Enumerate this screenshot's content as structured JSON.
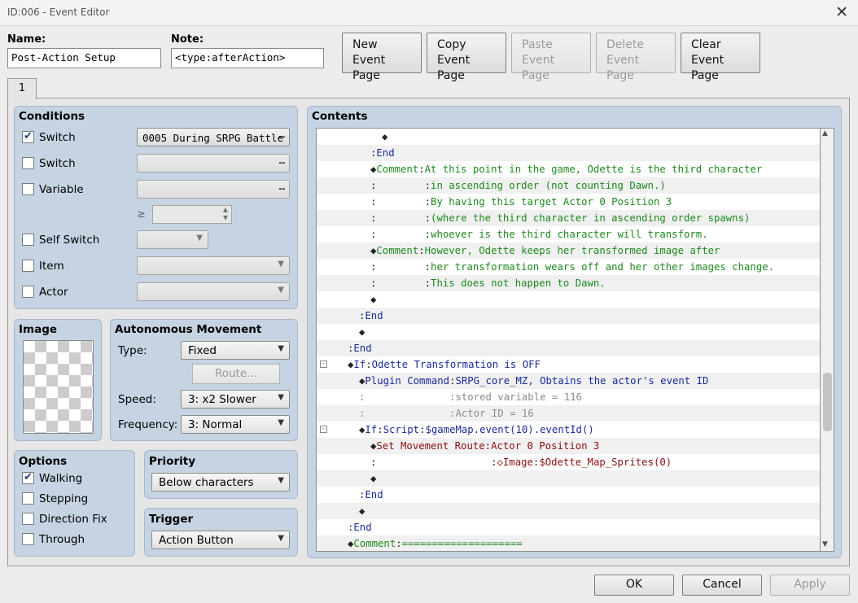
{
  "window": {
    "title": "ID:006 - Event Editor"
  },
  "header": {
    "name_label": "Name:",
    "name_value": "Post-Action Setup",
    "note_label": "Note:",
    "note_value": "<type:afterAction>"
  },
  "page_buttons": [
    {
      "line1": "New",
      "line2": "Event Page",
      "enabled": true
    },
    {
      "line1": "Copy",
      "line2": "Event Page",
      "enabled": true
    },
    {
      "line1": "Paste",
      "line2": "Event Page",
      "enabled": false
    },
    {
      "line1": "Delete",
      "line2": "Event Page",
      "enabled": false
    },
    {
      "line1": "Clear",
      "line2": "Event Page",
      "enabled": true
    }
  ],
  "tabs": [
    {
      "label": "1"
    }
  ],
  "conditions": {
    "title": "Conditions",
    "switch1": {
      "label": "Switch",
      "checked": true,
      "value": "0005 During SRPG Battle"
    },
    "switch2": {
      "label": "Switch",
      "checked": false,
      "value": ""
    },
    "variable": {
      "label": "Variable",
      "checked": false,
      "value": "",
      "operator": "≥"
    },
    "self_switch": {
      "label": "Self Switch",
      "checked": false
    },
    "item": {
      "label": "Item",
      "checked": false
    },
    "actor": {
      "label": "Actor",
      "checked": false
    }
  },
  "image_panel": {
    "title": "Image"
  },
  "autonomous_movement": {
    "title": "Autonomous Movement",
    "type_label": "Type:",
    "type_value": "Fixed",
    "route_button": "Route...",
    "speed_label": "Speed:",
    "speed_value": "3: x2 Slower",
    "frequency_label": "Frequency:",
    "frequency_value": "3: Normal"
  },
  "options": {
    "title": "Options",
    "walking": {
      "label": "Walking",
      "checked": true
    },
    "stepping": {
      "label": "Stepping",
      "checked": false
    },
    "direction_fix": {
      "label": "Direction Fix",
      "checked": false
    },
    "through": {
      "label": "Through",
      "checked": false
    }
  },
  "priority": {
    "title": "Priority",
    "value": "Below characters"
  },
  "trigger": {
    "title": "Trigger",
    "value": "Action Button"
  },
  "contents": {
    "title": "Contents",
    "lines": [
      {
        "indent": 5,
        "fold": "",
        "parts": [
          {
            "t": "◆",
            "c": "c-dark"
          }
        ]
      },
      {
        "indent": 4,
        "fold": "",
        "parts": [
          {
            "t": ":",
            "c": "c-dark"
          },
          {
            "t": "End",
            "c": "c-blue"
          }
        ]
      },
      {
        "indent": 4,
        "fold": "",
        "parts": [
          {
            "t": "◆",
            "c": "c-dark"
          },
          {
            "t": "Comment",
            "c": "c-green"
          },
          {
            "t": ":",
            "c": "c-dark"
          },
          {
            "t": "At this point in the game, Odette is the third character",
            "c": "c-green"
          }
        ]
      },
      {
        "indent": 4,
        "fold": "",
        "parts": [
          {
            "t": ":        :",
            "c": "c-dark"
          },
          {
            "t": "in ascending order (not counting Dawn.)",
            "c": "c-green"
          }
        ]
      },
      {
        "indent": 4,
        "fold": "",
        "parts": [
          {
            "t": ":        :",
            "c": "c-dark"
          },
          {
            "t": "By having this target Actor 0 Position 3",
            "c": "c-green"
          }
        ]
      },
      {
        "indent": 4,
        "fold": "",
        "parts": [
          {
            "t": ":        :",
            "c": "c-dark"
          },
          {
            "t": "(where the third character in ascending order spawns)",
            "c": "c-green"
          }
        ]
      },
      {
        "indent": 4,
        "fold": "",
        "parts": [
          {
            "t": ":        :",
            "c": "c-dark"
          },
          {
            "t": "whoever is the third character will transform.",
            "c": "c-green"
          }
        ]
      },
      {
        "indent": 4,
        "fold": "",
        "parts": [
          {
            "t": "◆",
            "c": "c-dark"
          },
          {
            "t": "Comment",
            "c": "c-green"
          },
          {
            "t": ":",
            "c": "c-dark"
          },
          {
            "t": "However, Odette keeps her transformed image after",
            "c": "c-green"
          }
        ]
      },
      {
        "indent": 4,
        "fold": "",
        "parts": [
          {
            "t": ":        :",
            "c": "c-dark"
          },
          {
            "t": "her transformation wears off and her other images change.",
            "c": "c-green"
          }
        ]
      },
      {
        "indent": 4,
        "fold": "",
        "parts": [
          {
            "t": ":        :",
            "c": "c-dark"
          },
          {
            "t": "This does not happen to Dawn.",
            "c": "c-green"
          }
        ]
      },
      {
        "indent": 4,
        "fold": "",
        "parts": [
          {
            "t": "◆",
            "c": "c-dark"
          }
        ]
      },
      {
        "indent": 3,
        "fold": "",
        "parts": [
          {
            "t": ":",
            "c": "c-dark"
          },
          {
            "t": "End",
            "c": "c-blue"
          }
        ]
      },
      {
        "indent": 3,
        "fold": "",
        "parts": [
          {
            "t": "◆",
            "c": "c-dark"
          }
        ]
      },
      {
        "indent": 2,
        "fold": "",
        "parts": [
          {
            "t": ":",
            "c": "c-dark"
          },
          {
            "t": "End",
            "c": "c-blue"
          }
        ]
      },
      {
        "indent": 2,
        "fold": "⊟",
        "parts": [
          {
            "t": "◆",
            "c": "c-dark"
          },
          {
            "t": "If",
            "c": "c-blue"
          },
          {
            "t": ":",
            "c": "c-dark"
          },
          {
            "t": "Odette Transformation is OFF",
            "c": "c-blue"
          }
        ]
      },
      {
        "indent": 3,
        "fold": "",
        "parts": [
          {
            "t": "◆",
            "c": "c-dark"
          },
          {
            "t": "Plugin Command",
            "c": "c-blue"
          },
          {
            "t": ":",
            "c": "c-dark"
          },
          {
            "t": "SRPG_core_MZ, Obtains the actor's event ID",
            "c": "c-blue"
          }
        ]
      },
      {
        "indent": 3,
        "fold": "",
        "parts": [
          {
            "t": ":              :",
            "c": "c-gray"
          },
          {
            "t": "stored variable = 116",
            "c": "c-gray"
          }
        ]
      },
      {
        "indent": 3,
        "fold": "",
        "parts": [
          {
            "t": ":              :",
            "c": "c-gray"
          },
          {
            "t": "Actor ID = 16",
            "c": "c-gray"
          }
        ]
      },
      {
        "indent": 3,
        "fold": "⊟",
        "parts": [
          {
            "t": "◆",
            "c": "c-dark"
          },
          {
            "t": "If",
            "c": "c-blue"
          },
          {
            "t": ":",
            "c": "c-dark"
          },
          {
            "t": "Script",
            "c": "c-blue"
          },
          {
            "t": ":",
            "c": "c-dark"
          },
          {
            "t": "$gameMap.event(10).eventId()",
            "c": "c-blue"
          }
        ]
      },
      {
        "indent": 4,
        "fold": "",
        "parts": [
          {
            "t": "◆",
            "c": "c-dark"
          },
          {
            "t": "Set Movement Route",
            "c": "c-red"
          },
          {
            "t": ":",
            "c": "c-dark"
          },
          {
            "t": "Actor 0 Position 3",
            "c": "c-red"
          }
        ]
      },
      {
        "indent": 4,
        "fold": "",
        "parts": [
          {
            "t": ":                   :",
            "c": "c-dark"
          },
          {
            "t": "◇Image",
            "c": "c-red"
          },
          {
            "t": ":",
            "c": "c-dark"
          },
          {
            "t": "$Odette_Map_Sprites(0)",
            "c": "c-red"
          }
        ]
      },
      {
        "indent": 4,
        "fold": "",
        "parts": [
          {
            "t": "◆",
            "c": "c-dark"
          }
        ]
      },
      {
        "indent": 3,
        "fold": "",
        "parts": [
          {
            "t": ":",
            "c": "c-dark"
          },
          {
            "t": "End",
            "c": "c-blue"
          }
        ]
      },
      {
        "indent": 3,
        "fold": "",
        "parts": [
          {
            "t": "◆",
            "c": "c-dark"
          }
        ]
      },
      {
        "indent": 2,
        "fold": "",
        "parts": [
          {
            "t": ":",
            "c": "c-dark"
          },
          {
            "t": "End",
            "c": "c-blue"
          }
        ]
      },
      {
        "indent": 2,
        "fold": "",
        "parts": [
          {
            "t": "◆",
            "c": "c-dark"
          },
          {
            "t": "Comment",
            "c": "c-green"
          },
          {
            "t": ":",
            "c": "c-dark"
          },
          {
            "t": "====================",
            "c": "c-green"
          }
        ]
      }
    ]
  },
  "footer": {
    "ok": "OK",
    "cancel": "Cancel",
    "apply": "Apply"
  }
}
